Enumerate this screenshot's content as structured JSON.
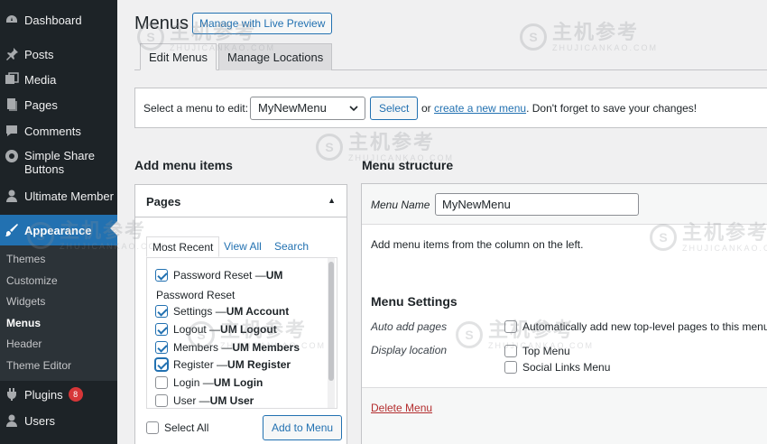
{
  "sidebar": {
    "items": [
      {
        "name": "dashboard",
        "label": "Dashboard",
        "icon": "dashboard-icon"
      },
      {
        "name": "posts",
        "label": "Posts",
        "icon": "pin-icon"
      },
      {
        "name": "media",
        "label": "Media",
        "icon": "media-icon"
      },
      {
        "name": "pages",
        "label": "Pages",
        "icon": "page-icon"
      },
      {
        "name": "comments",
        "label": "Comments",
        "icon": "comment-icon"
      },
      {
        "name": "simple-share-buttons",
        "label": "Simple Share Buttons",
        "icon": "share-icon"
      },
      {
        "name": "ultimate-member",
        "label": "Ultimate Member",
        "icon": "user-icon"
      },
      {
        "name": "appearance",
        "label": "Appearance",
        "icon": "brush-icon"
      },
      {
        "name": "plugins",
        "label": "Plugins",
        "icon": "plugin-icon",
        "badge": "8"
      },
      {
        "name": "users",
        "label": "Users",
        "icon": "users-icon"
      }
    ],
    "appearance_submenu": [
      "Themes",
      "Customize",
      "Widgets",
      "Menus",
      "Header",
      "Theme Editor"
    ],
    "current_submenu": "Menus"
  },
  "header": {
    "title": "Menus",
    "live_preview_label": "Manage with Live Preview"
  },
  "tabs": [
    {
      "label": "Edit Menus",
      "active": true
    },
    {
      "label": "Manage Locations",
      "active": false
    }
  ],
  "manage_bar": {
    "label": "Select a menu to edit:",
    "selected_menu": "MyNewMenu",
    "select_button": "Select",
    "or_text": "or",
    "create_link": "create a new menu",
    "after_text": ". Don't forget to save your changes!"
  },
  "add_items": {
    "heading": "Add menu items",
    "panel_title": "Pages",
    "subtabs": [
      "Most Recent",
      "View All",
      "Search"
    ],
    "entries": [
      {
        "pre": "Password Reset — ",
        "bold": "UM",
        "checked": true
      },
      {
        "group": "Password Reset"
      },
      {
        "pre": "Settings — ",
        "bold": "UM Account",
        "checked": true
      },
      {
        "pre": "Logout — ",
        "bold": "UM Logout",
        "checked": true
      },
      {
        "pre": "Members — ",
        "bold": "UM Members",
        "checked": true
      },
      {
        "pre": "Register — ",
        "bold": "UM Register",
        "checked": true
      },
      {
        "pre": "Login — ",
        "bold": "UM Login",
        "checked": false
      },
      {
        "pre": "User — ",
        "bold": "UM User",
        "checked": false
      }
    ],
    "select_all": "Select All",
    "add_button": "Add to Menu"
  },
  "structure": {
    "heading": "Menu structure",
    "name_label": "Menu Name",
    "name_value": "MyNewMenu",
    "hint": "Add menu items from the column on the left.",
    "settings_title": "Menu Settings",
    "auto_add_label": "Auto add pages",
    "auto_add_option": "Automatically add new top-level pages to this menu",
    "display_label": "Display location",
    "locations": [
      "Top Menu",
      "Social Links Menu"
    ],
    "delete_link": "Delete Menu"
  },
  "watermark": {
    "cn": "主机参考",
    "en": "ZHUJICANKAO.COM"
  },
  "colors": {
    "accent": "#2271b1",
    "sidebar_bg": "#1d2327",
    "danger": "#b32d2e"
  }
}
